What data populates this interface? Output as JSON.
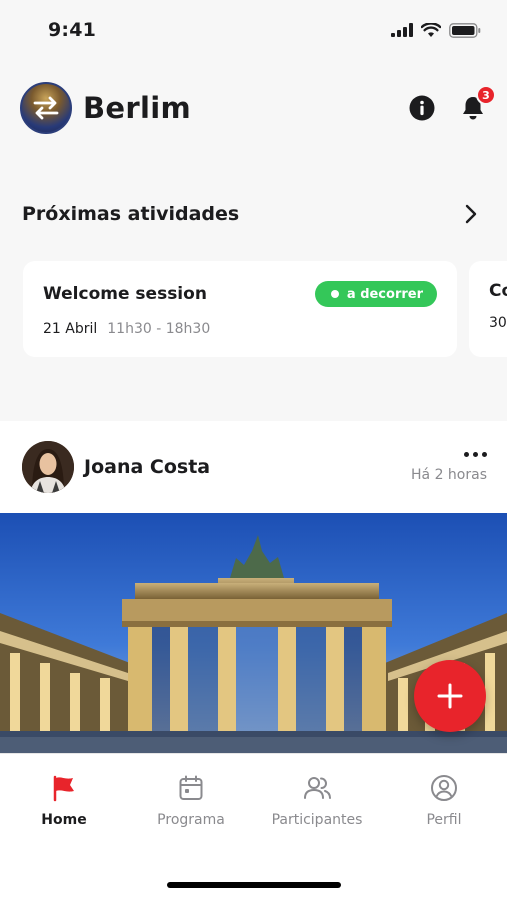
{
  "status_bar": {
    "time": "9:41"
  },
  "header": {
    "event_name": "Berlim",
    "notification_count": "3"
  },
  "upcoming": {
    "title": "Próximas atividades",
    "cards": [
      {
        "title": "Welcome session",
        "date": "21 Abril",
        "time": "11h30 - 18h30",
        "status": "a decorrer"
      },
      {
        "title": "Co",
        "date": "30"
      }
    ]
  },
  "post": {
    "author": "Joana Costa",
    "time": "Há 2 horas"
  },
  "tabs": [
    {
      "label": "Home",
      "icon": "flag-icon",
      "active": true
    },
    {
      "label": "Programa",
      "icon": "calendar-icon",
      "active": false
    },
    {
      "label": "Participantes",
      "icon": "users-icon",
      "active": false
    },
    {
      "label": "Perfil",
      "icon": "user-circle-icon",
      "active": false
    }
  ],
  "colors": {
    "accent": "#e8242b",
    "status_green": "#34c759",
    "text": "#1c1c1e",
    "muted": "#8a8a8e"
  }
}
